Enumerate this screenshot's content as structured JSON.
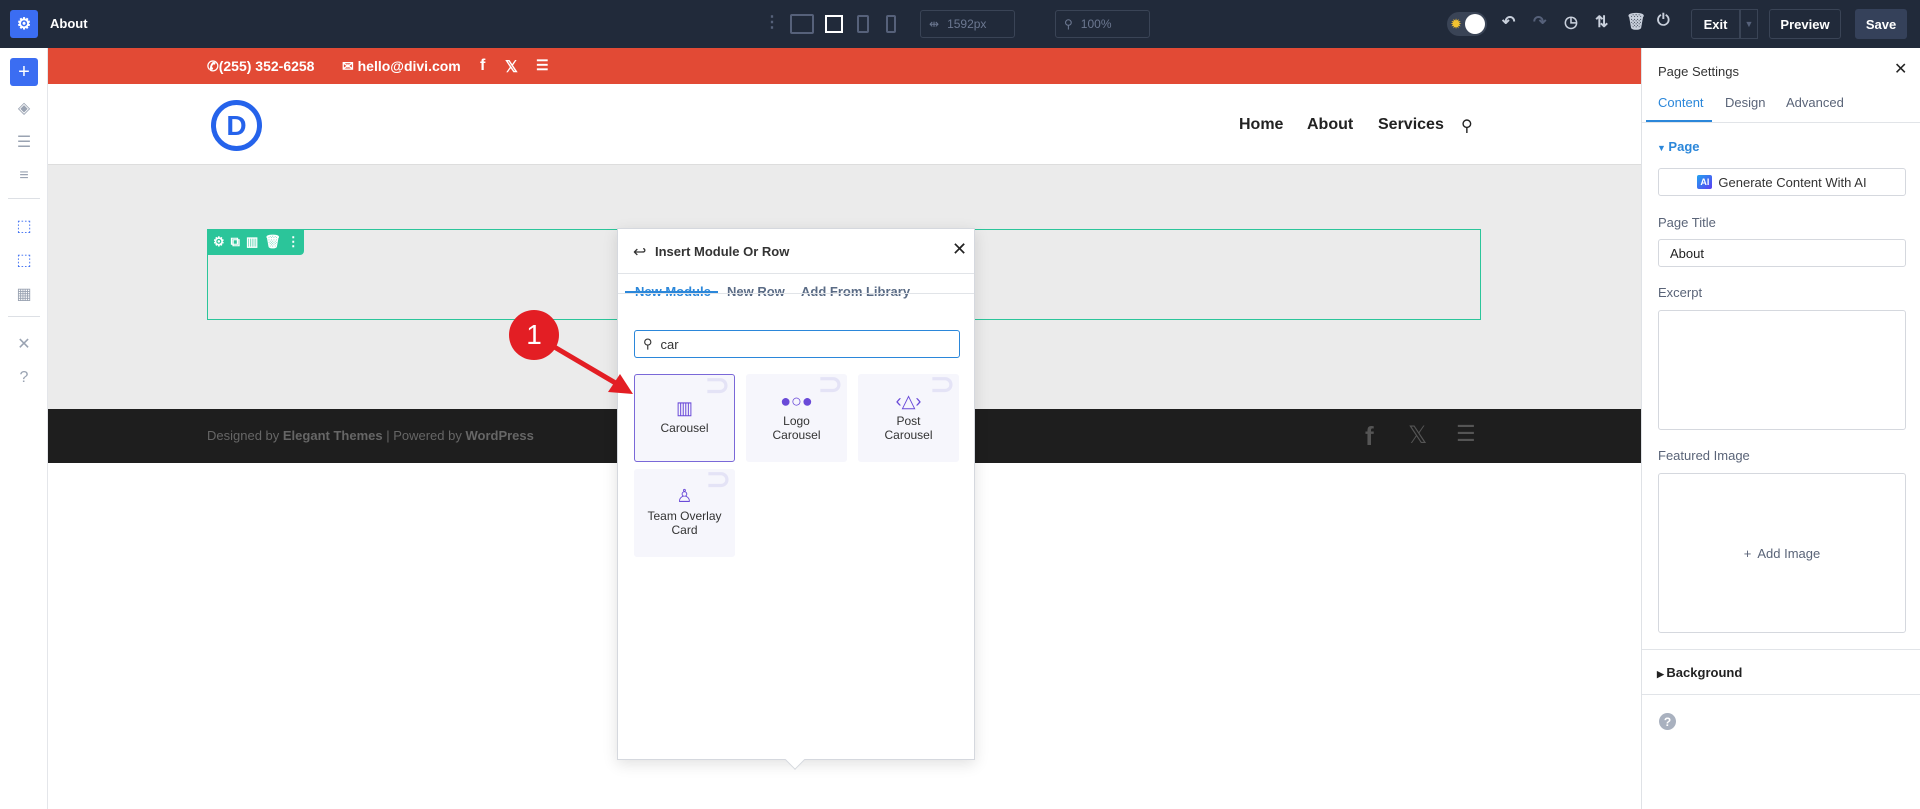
{
  "topbar": {
    "title": "About",
    "width_value": "1592px",
    "zoom_value": "100%",
    "exit_label": "Exit",
    "preview_label": "Preview",
    "save_label": "Save"
  },
  "site": {
    "phone": "(255) 352-6258",
    "email": "hello@divi.com",
    "logo_letter": "D",
    "nav": [
      "Home",
      "About",
      "Services"
    ],
    "footer": {
      "designed_by": "Designed by ",
      "elegant": "Elegant Themes",
      "powered": " | Powered by ",
      "wordpress": "WordPress"
    }
  },
  "popup": {
    "title": "Insert Module Or Row",
    "tabs": [
      "New Module",
      "New Row",
      "Add From Library"
    ],
    "search_value": "car",
    "modules": [
      {
        "label": "Carousel"
      },
      {
        "label": "Logo Carousel"
      },
      {
        "label": "Post Carousel"
      },
      {
        "label": "Team Overlay Card"
      }
    ]
  },
  "annotation": {
    "badge": "1"
  },
  "panel": {
    "title": "Page Settings",
    "tabs": [
      "Content",
      "Design",
      "Advanced"
    ],
    "section_page": "Page",
    "ai_button": "Generate Content With AI",
    "ai_icon": "AI",
    "page_title_label": "Page Title",
    "page_title_value": "About",
    "excerpt_label": "Excerpt",
    "excerpt_value": "",
    "featured_label": "Featured Image",
    "add_image": "Add Image",
    "section_background": "Background"
  },
  "colors": {
    "accent": "#2b87da",
    "brand_red": "#e24a35",
    "row_green": "#2bc59a",
    "module_purple": "#6a4ad8",
    "badge_red": "#e31e24"
  }
}
